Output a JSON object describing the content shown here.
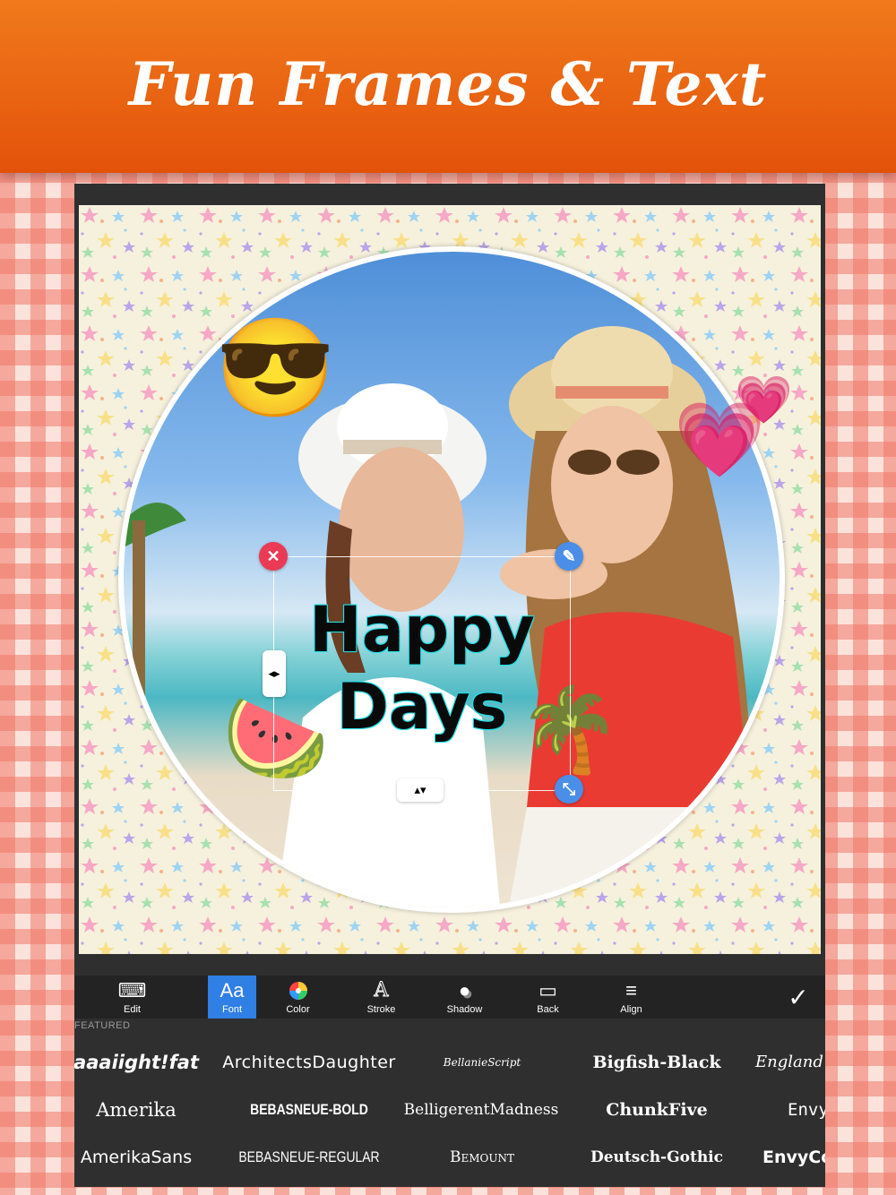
{
  "banner": {
    "title": "Fun Frames & Text"
  },
  "canvas": {
    "text_content": [
      "Happy",
      "Days"
    ],
    "stickers": {
      "sunglasses": "😎",
      "watermelon": "🍉",
      "palm": "🌴",
      "heart_big": "💗",
      "heart_small": "💗"
    },
    "handles": {
      "close": "✕",
      "edit": "✎",
      "resize": "⤡",
      "side": "◂▸",
      "bottom": "▴▾"
    }
  },
  "toolbar": {
    "items": [
      {
        "label": "Edit",
        "icon": "⌨"
      },
      {
        "label": "Font",
        "icon": "Aa"
      },
      {
        "label": "Color",
        "icon": "◕"
      },
      {
        "label": "Stroke",
        "icon": "A"
      },
      {
        "label": "Shadow",
        "icon": "●"
      },
      {
        "label": "Back",
        "icon": "▭"
      },
      {
        "label": "Align",
        "icon": "≡"
      }
    ],
    "done_icon": "✓"
  },
  "font_section": {
    "heading": "FEATURED",
    "rows": [
      [
        "aaaiight!fat",
        "ArchitectsDaughter",
        "BellanieScript",
        "Bigfish-Black",
        "England"
      ],
      [
        "Amerika",
        "BEBASNEUE-BOLD",
        "BelligerentMadness",
        "ChunkFive",
        "Envy"
      ],
      [
        "AmerikaSans",
        "BEBASNEUE-REGULAR",
        "Bemount",
        "Deutsch-Gothic",
        "EnvyCo"
      ]
    ]
  },
  "colors": {
    "banner": "#f07a1c",
    "accent": "#2f7fe4",
    "close": "#ea3a55",
    "text_stroke": "#23e0e8"
  }
}
